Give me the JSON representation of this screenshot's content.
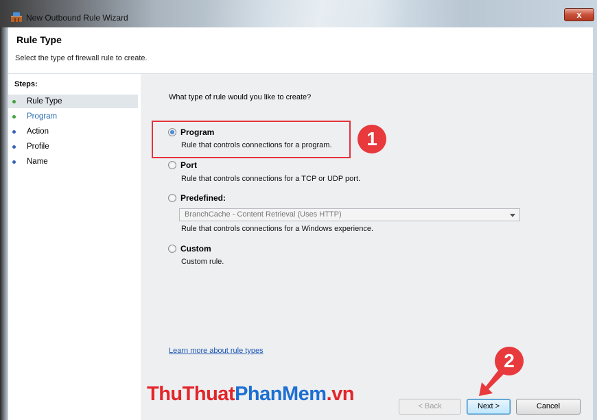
{
  "window": {
    "title": "New Outbound Rule Wizard",
    "close_label": "x"
  },
  "header": {
    "title": "Rule Type",
    "subtitle": "Select the type of firewall rule to create."
  },
  "steps": {
    "label": "Steps:",
    "items": [
      {
        "label": "Rule Type",
        "color": "#3ea43a"
      },
      {
        "label": "Program",
        "color": "#3ea43a"
      },
      {
        "label": "Action",
        "color": "#3a63b8"
      },
      {
        "label": "Profile",
        "color": "#3a63b8"
      },
      {
        "label": "Name",
        "color": "#3a63b8"
      }
    ]
  },
  "main": {
    "question": "What type of rule would you like to create?",
    "options": [
      {
        "label": "Program",
        "description": "Rule that controls connections for a program.",
        "selected": true
      },
      {
        "label": "Port",
        "description": "Rule that controls connections for a TCP or UDP port.",
        "selected": false
      },
      {
        "label": "Predefined:",
        "description": "Rule that controls connections for a Windows experience.",
        "selected": false
      },
      {
        "label": "Custom",
        "description": "Custom rule.",
        "selected": false
      }
    ],
    "predefined_select_value": "BranchCache - Content Retrieval (Uses HTTP)",
    "learn_more": "Learn more about rule types"
  },
  "buttons": {
    "back": "< Back",
    "next": "Next >",
    "cancel": "Cancel"
  },
  "annotations": {
    "badge1": "1",
    "badge2": "2",
    "highlight_color": "#e4323a"
  },
  "watermark": {
    "part1": "ThuThuat",
    "part2": "PhanMem",
    "part3": ".vn"
  }
}
